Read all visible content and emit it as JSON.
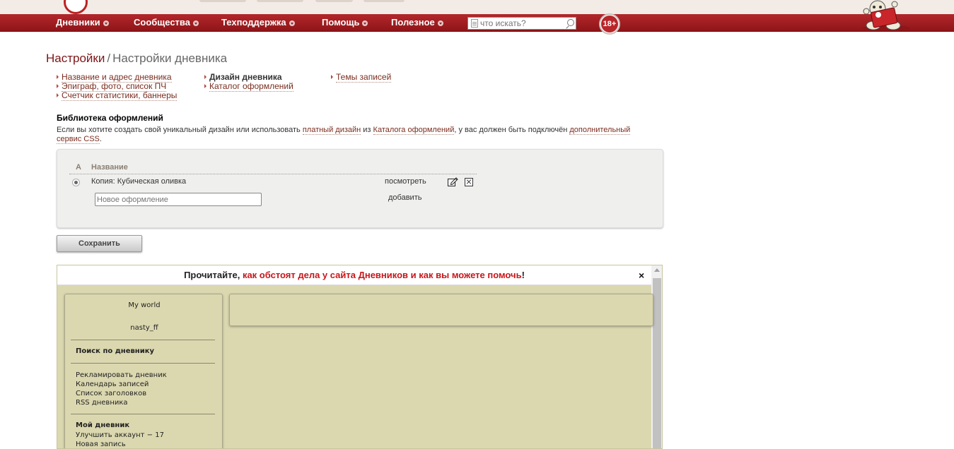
{
  "nav": {
    "items": [
      "Дневники",
      "Сообщества",
      "Техподдержка",
      "Помощь",
      "Полезное"
    ],
    "search_placeholder": "что искать?",
    "age_badge": "18+"
  },
  "breadcrumb": {
    "root": "Настройки",
    "separator": "/",
    "current": "Настройки дневника"
  },
  "settings_menu": {
    "col1": [
      "Название и адрес дневника",
      "Эпиграф, фото, список ПЧ",
      "Счетчик статистики, баннеры"
    ],
    "col2_active": "Дизайн дневника",
    "col2": [
      "Каталог оформлений"
    ],
    "col3": [
      "Темы записей"
    ]
  },
  "library": {
    "title": "Библиотека оформлений",
    "desc_part1": "Если вы хотите создать свой уникальный дизайн или использовать ",
    "desc_link1": "платный дизайн",
    "desc_part2": " из ",
    "desc_link2": "Каталога оформлений",
    "desc_part3": ", у вас должен быть подключён ",
    "desc_link3": "дополнительный сервис CSS",
    "desc_part4": "."
  },
  "designs_table": {
    "col_a": "А",
    "col_name": "Название",
    "row": {
      "name": "Копия: Кубическая оливка",
      "view": "посмотреть"
    },
    "new_placeholder": "Новое оформление",
    "add": "добавить"
  },
  "save_label": "Сохранить",
  "notice": {
    "prefix": "Прочитайте, ",
    "highlight": "как обстоят дела у сайта Дневников и как вы можете помочь",
    "suffix": "!",
    "close": "×"
  },
  "preview_sidebar": {
    "diary_title": "My world",
    "username": "nasty_ff",
    "search_heading": "Поиск по дневнику",
    "links": [
      "Рекламировать дневник",
      "Календарь записей",
      "Список заголовков",
      "RSS дневника"
    ],
    "my_diary_heading": "Мой дневник",
    "upgrade": "Улучшить аккаунт − 17",
    "new_post": "Новая запись"
  },
  "colors": {
    "nav_red": "#a01e22",
    "link_brown": "#7a2d1f",
    "preview_bg": "#dbd8b0",
    "notice_red": "#c8161a"
  }
}
